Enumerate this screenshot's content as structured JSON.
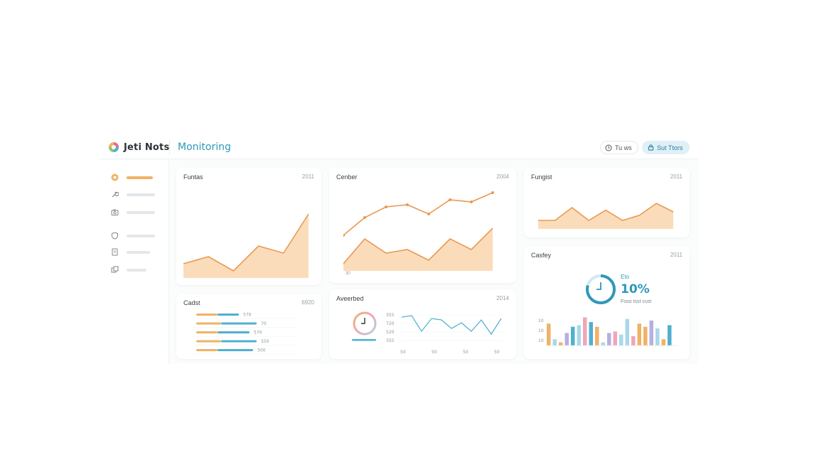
{
  "header": {
    "app_name": "Jeti Nots",
    "page_title": "Monitoring",
    "time_button": "Tu ws",
    "primary_button": "Sut Ttors"
  },
  "sidebar": {
    "items": [
      {
        "icon": "circle-dot-icon",
        "active": true
      },
      {
        "icon": "wrench-icon",
        "active": false
      },
      {
        "icon": "camera-icon",
        "active": false
      },
      {
        "icon": "shield-icon",
        "active": false
      },
      {
        "icon": "document-icon",
        "active": false
      },
      {
        "icon": "layers-icon",
        "active": false
      }
    ]
  },
  "colors": {
    "accent": "#2f98b8",
    "orange": "#f0b266",
    "orange_fill": "#fbdcba",
    "orange_line": "#e89a52",
    "teal": "#4fb0cf",
    "pink": "#f0a6b8",
    "purple": "#b8aee0",
    "light_blue": "#a8d8ea"
  },
  "cards": {
    "c1": {
      "title": "Funtas",
      "meta": "2011"
    },
    "c2": {
      "title": "Cenber",
      "meta": "2004",
      "tick": "30"
    },
    "c3": {
      "title": "Fungist",
      "meta": "2011"
    },
    "c4": {
      "title": "Cadst",
      "meta": "6920"
    },
    "c5": {
      "title": "Aveerbed",
      "meta": "2014"
    },
    "c6": {
      "title": "Casfey",
      "meta": "2011"
    }
  },
  "gauge": {
    "top_label": "Eto",
    "value": "10%",
    "subtitle": "Foso tsst cust"
  },
  "chart_data": [
    {
      "type": "area",
      "title": "Funtas",
      "series": [
        {
          "values": [
            2,
            3,
            1,
            4.5,
            3.5,
            9
          ]
        }
      ]
    },
    {
      "type": "line",
      "title": "Cenber",
      "series": [
        {
          "values": [
            5,
            7.5,
            9,
            9.3,
            8,
            10,
            9.7,
            11
          ]
        },
        {
          "values": [
            1,
            4.5,
            2.5,
            3,
            1.5,
            4.5,
            3,
            6
          ]
        }
      ]
    },
    {
      "type": "area",
      "title": "Fungist",
      "series": [
        {
          "values": [
            1,
            1,
            2.5,
            1,
            2.2,
            1,
            1.6,
            3,
            2
          ]
        }
      ]
    },
    {
      "type": "bar",
      "title": "Cadst",
      "series": [
        {
          "values": [
            6,
            8,
            7.5,
            8,
            8
          ]
        },
        {
          "values": [
            3,
            3.5,
            3,
            3.5,
            3
          ]
        }
      ],
      "tick_labels": [
        "570",
        "70",
        "570",
        "550",
        "500"
      ],
      "x_labels": [
        "",
        "",
        "",
        "",
        "",
        ""
      ]
    },
    {
      "type": "line",
      "title": "Aveerbed",
      "series": [
        {
          "values": [
            9,
            9.5,
            4,
            8.5,
            8,
            5,
            7,
            4,
            8,
            3,
            8.5
          ]
        }
      ],
      "y_tick_labels": [
        "355",
        "720",
        "520",
        "355"
      ],
      "x_tick_labels": [
        "50",
        "50",
        "50",
        "50"
      ]
    },
    {
      "type": "bar",
      "title": "Casfey",
      "series": [
        {
          "values": [
            7,
            2,
            1,
            4,
            6,
            6.5,
            9,
            7.5,
            6,
            1,
            4,
            4.5,
            3.5,
            8.5,
            3,
            7,
            6,
            8,
            5.5,
            2,
            6.5
          ]
        }
      ],
      "bar_colors": [
        "#f0b266",
        "#a8d8ea",
        "#f0b266",
        "#b8aee0",
        "#4fb0cf",
        "#a8d8ea",
        "#f0a6b8",
        "#4fb0cf",
        "#f0b266",
        "#a8d8ea",
        "#b8aee0",
        "#f0a6b8",
        "#a8d8ea",
        "#a8d8ea",
        "#f0a6b8",
        "#f0b266",
        "#f0b266",
        "#b8aee0",
        "#a8d8ea",
        "#f0b266",
        "#4fb0cf"
      ],
      "y_tick_labels": [
        "10",
        "10",
        "10"
      ]
    }
  ]
}
